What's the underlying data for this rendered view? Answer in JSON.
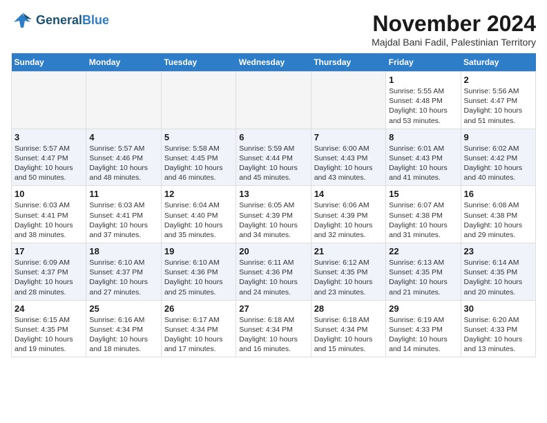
{
  "header": {
    "logo_line1": "General",
    "logo_line2": "Blue",
    "month_title": "November 2024",
    "location": "Majdal Bani Fadil, Palestinian Territory"
  },
  "weekdays": [
    "Sunday",
    "Monday",
    "Tuesday",
    "Wednesday",
    "Thursday",
    "Friday",
    "Saturday"
  ],
  "rows": [
    [
      {
        "day": "",
        "empty": true
      },
      {
        "day": "",
        "empty": true
      },
      {
        "day": "",
        "empty": true
      },
      {
        "day": "",
        "empty": true
      },
      {
        "day": "",
        "empty": true
      },
      {
        "day": "1",
        "sunrise": "5:55 AM",
        "sunset": "4:48 PM",
        "daylight": "10 hours and 53 minutes."
      },
      {
        "day": "2",
        "sunrise": "5:56 AM",
        "sunset": "4:47 PM",
        "daylight": "10 hours and 51 minutes."
      }
    ],
    [
      {
        "day": "3",
        "sunrise": "5:57 AM",
        "sunset": "4:47 PM",
        "daylight": "10 hours and 50 minutes."
      },
      {
        "day": "4",
        "sunrise": "5:57 AM",
        "sunset": "4:46 PM",
        "daylight": "10 hours and 48 minutes."
      },
      {
        "day": "5",
        "sunrise": "5:58 AM",
        "sunset": "4:45 PM",
        "daylight": "10 hours and 46 minutes."
      },
      {
        "day": "6",
        "sunrise": "5:59 AM",
        "sunset": "4:44 PM",
        "daylight": "10 hours and 45 minutes."
      },
      {
        "day": "7",
        "sunrise": "6:00 AM",
        "sunset": "4:43 PM",
        "daylight": "10 hours and 43 minutes."
      },
      {
        "day": "8",
        "sunrise": "6:01 AM",
        "sunset": "4:43 PM",
        "daylight": "10 hours and 41 minutes."
      },
      {
        "day": "9",
        "sunrise": "6:02 AM",
        "sunset": "4:42 PM",
        "daylight": "10 hours and 40 minutes."
      }
    ],
    [
      {
        "day": "10",
        "sunrise": "6:03 AM",
        "sunset": "4:41 PM",
        "daylight": "10 hours and 38 minutes."
      },
      {
        "day": "11",
        "sunrise": "6:03 AM",
        "sunset": "4:41 PM",
        "daylight": "10 hours and 37 minutes."
      },
      {
        "day": "12",
        "sunrise": "6:04 AM",
        "sunset": "4:40 PM",
        "daylight": "10 hours and 35 minutes."
      },
      {
        "day": "13",
        "sunrise": "6:05 AM",
        "sunset": "4:39 PM",
        "daylight": "10 hours and 34 minutes."
      },
      {
        "day": "14",
        "sunrise": "6:06 AM",
        "sunset": "4:39 PM",
        "daylight": "10 hours and 32 minutes."
      },
      {
        "day": "15",
        "sunrise": "6:07 AM",
        "sunset": "4:38 PM",
        "daylight": "10 hours and 31 minutes."
      },
      {
        "day": "16",
        "sunrise": "6:08 AM",
        "sunset": "4:38 PM",
        "daylight": "10 hours and 29 minutes."
      }
    ],
    [
      {
        "day": "17",
        "sunrise": "6:09 AM",
        "sunset": "4:37 PM",
        "daylight": "10 hours and 28 minutes."
      },
      {
        "day": "18",
        "sunrise": "6:10 AM",
        "sunset": "4:37 PM",
        "daylight": "10 hours and 27 minutes."
      },
      {
        "day": "19",
        "sunrise": "6:10 AM",
        "sunset": "4:36 PM",
        "daylight": "10 hours and 25 minutes."
      },
      {
        "day": "20",
        "sunrise": "6:11 AM",
        "sunset": "4:36 PM",
        "daylight": "10 hours and 24 minutes."
      },
      {
        "day": "21",
        "sunrise": "6:12 AM",
        "sunset": "4:35 PM",
        "daylight": "10 hours and 23 minutes."
      },
      {
        "day": "22",
        "sunrise": "6:13 AM",
        "sunset": "4:35 PM",
        "daylight": "10 hours and 21 minutes."
      },
      {
        "day": "23",
        "sunrise": "6:14 AM",
        "sunset": "4:35 PM",
        "daylight": "10 hours and 20 minutes."
      }
    ],
    [
      {
        "day": "24",
        "sunrise": "6:15 AM",
        "sunset": "4:35 PM",
        "daylight": "10 hours and 19 minutes."
      },
      {
        "day": "25",
        "sunrise": "6:16 AM",
        "sunset": "4:34 PM",
        "daylight": "10 hours and 18 minutes."
      },
      {
        "day": "26",
        "sunrise": "6:17 AM",
        "sunset": "4:34 PM",
        "daylight": "10 hours and 17 minutes."
      },
      {
        "day": "27",
        "sunrise": "6:18 AM",
        "sunset": "4:34 PM",
        "daylight": "10 hours and 16 minutes."
      },
      {
        "day": "28",
        "sunrise": "6:18 AM",
        "sunset": "4:34 PM",
        "daylight": "10 hours and 15 minutes."
      },
      {
        "day": "29",
        "sunrise": "6:19 AM",
        "sunset": "4:33 PM",
        "daylight": "10 hours and 14 minutes."
      },
      {
        "day": "30",
        "sunrise": "6:20 AM",
        "sunset": "4:33 PM",
        "daylight": "10 hours and 13 minutes."
      }
    ]
  ]
}
